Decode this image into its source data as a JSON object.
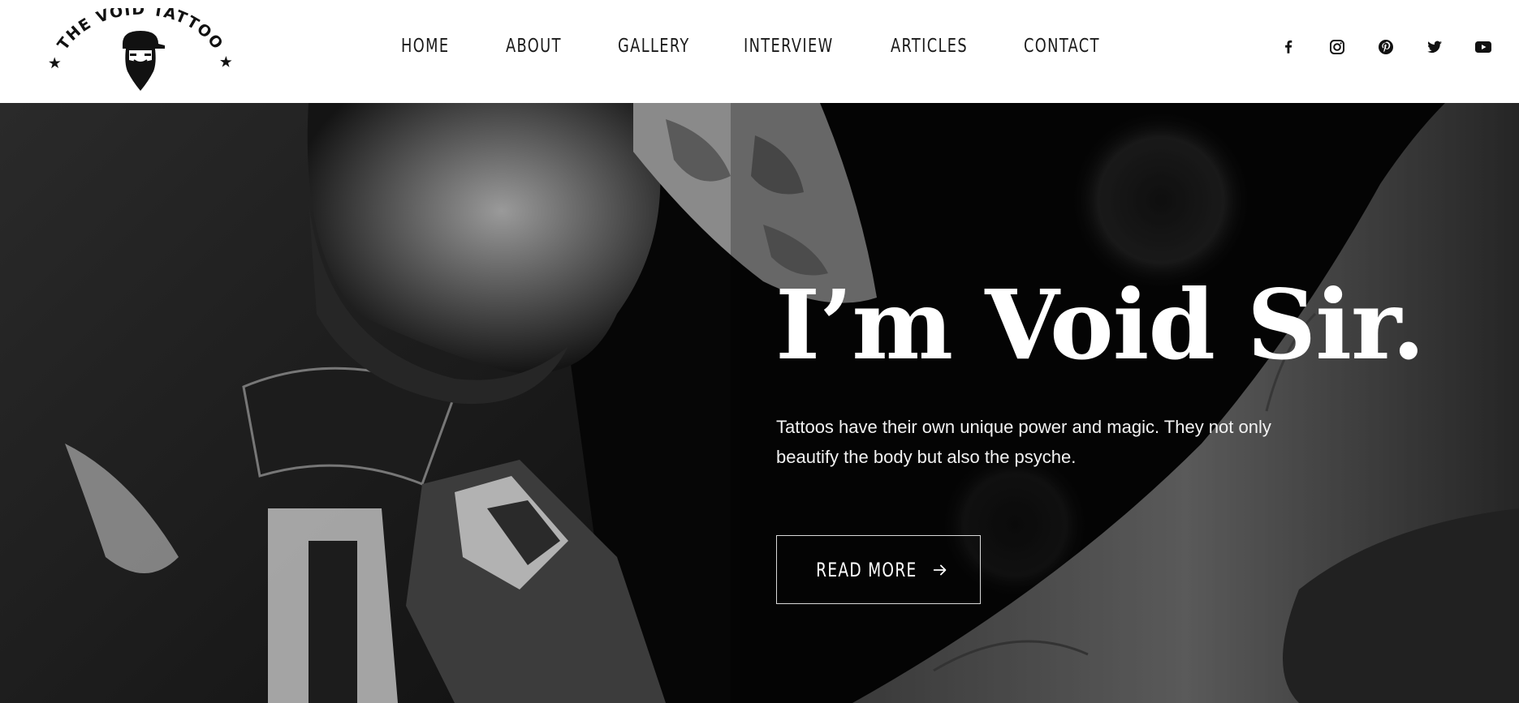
{
  "brand": {
    "logo_text": "THE VOID TATTOO"
  },
  "nav": {
    "items": [
      {
        "label": "HOME"
      },
      {
        "label": "ABOUT"
      },
      {
        "label": "GALLERY"
      },
      {
        "label": "INTERVIEW"
      },
      {
        "label": "ARTICLES"
      },
      {
        "label": "CONTACT"
      }
    ]
  },
  "social": {
    "icons": [
      "facebook-icon",
      "instagram-icon",
      "pinterest-icon",
      "twitter-icon",
      "youtube-icon"
    ]
  },
  "hero": {
    "title": "I’m Void Sir.",
    "text": "Tattoos have their own unique power and magic. They not only beautify the body but also the psyche.",
    "button_label": "READ MORE",
    "button_icon": "arrow-right-icon"
  },
  "colors": {
    "header_bg": "#ffffff",
    "nav_text": "#1a1a1a",
    "hero_bg": "#060606",
    "hero_text": "#ffffff",
    "button_border": "#d9d9d9"
  }
}
